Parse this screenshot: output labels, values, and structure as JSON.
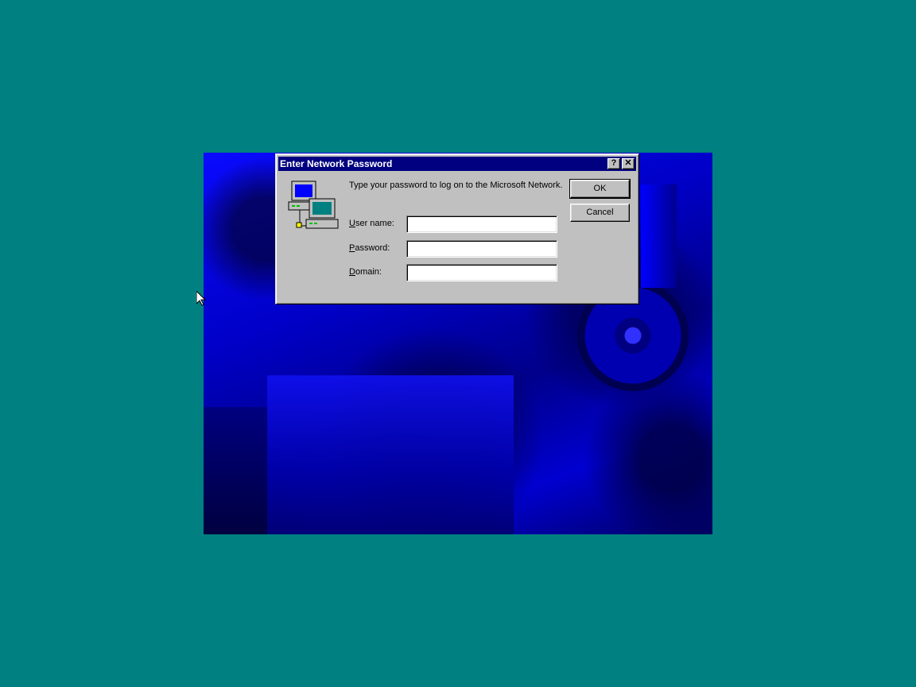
{
  "dialog": {
    "title": "Enter Network Password",
    "message": "Type your password to log on to the Microsoft Network.",
    "help_button": "?",
    "close_button": "✕",
    "icon": "network-computers-icon",
    "fields": {
      "username": {
        "label_underlined": "U",
        "label_rest": "ser name:",
        "value": ""
      },
      "password": {
        "label_underlined": "P",
        "label_rest": "assword:",
        "value": ""
      },
      "domain": {
        "label_underlined": "D",
        "label_rest": "omain:",
        "value": ""
      }
    },
    "ok_label": "OK",
    "cancel_label": "Cancel"
  },
  "colors": {
    "desktop": "#008080",
    "titlebar": "#000080",
    "face": "#c0c0c0"
  }
}
